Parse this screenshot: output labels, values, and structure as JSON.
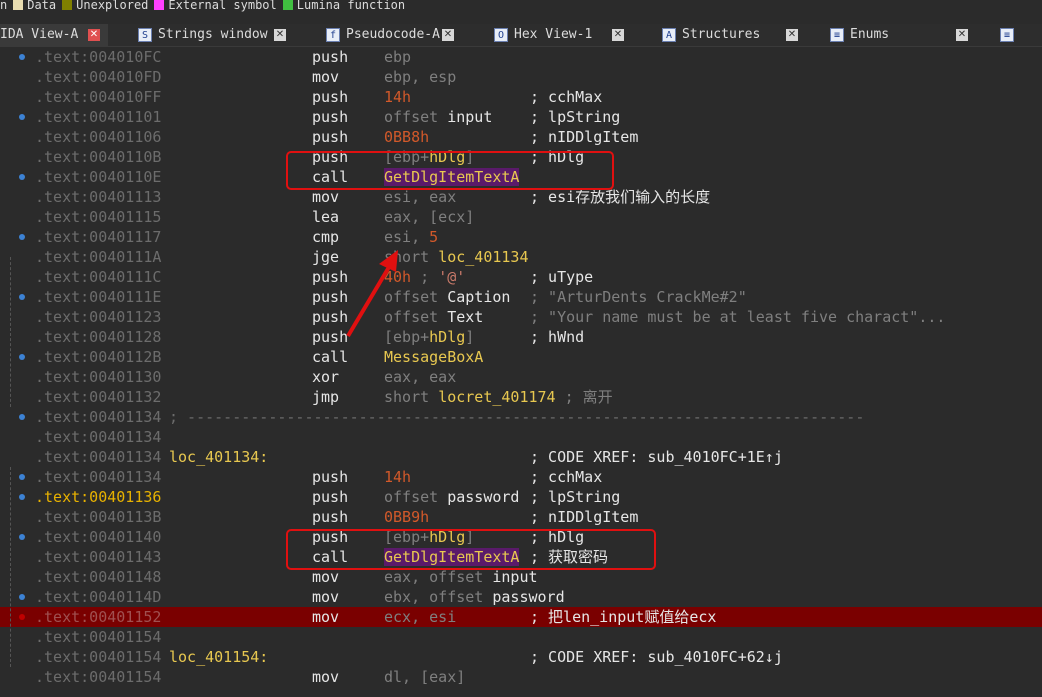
{
  "legend": [
    {
      "label": "n",
      "color": ""
    },
    {
      "label": "Data",
      "color": "#e8dcb0"
    },
    {
      "label": "Unexplored",
      "color": "#808000"
    },
    {
      "label": "External symbol",
      "color": "#ff40ff"
    },
    {
      "label": "Lumina function",
      "color": "#40c040"
    }
  ],
  "tabs": [
    {
      "label": "IDA View-A",
      "icon": "ida-view-icon",
      "glyph": "",
      "active": true
    },
    {
      "label": "Strings window",
      "icon": "strings-icon",
      "glyph": "S",
      "active": false
    },
    {
      "label": "Pseudocode-A",
      "icon": "pseudocode-icon",
      "glyph": "f",
      "active": false
    },
    {
      "label": "Hex View-1",
      "icon": "hex-view-icon",
      "glyph": "O",
      "active": false
    },
    {
      "label": "Structures",
      "icon": "structures-icon",
      "glyph": "A",
      "active": false
    },
    {
      "label": "Enums",
      "icon": "enums-icon",
      "glyph": "≡",
      "active": false
    },
    {
      "label": "",
      "icon": "imports-icon",
      "glyph": "≡",
      "active": false
    }
  ],
  "tab_close_glyph": "✕",
  "listing": [
    {
      "addr": ".text:004010FC",
      "mn": "push",
      "op": [
        [
          "k",
          "ebp"
        ]
      ]
    },
    {
      "addr": ".text:004010FD",
      "mn": "mov",
      "op": [
        [
          "k",
          "ebp, esp"
        ]
      ]
    },
    {
      "addr": ".text:004010FF",
      "mn": "push",
      "op": [
        [
          "n",
          "14h"
        ]
      ],
      "cm": "; cchMax"
    },
    {
      "addr": ".text:00401101",
      "mn": "push",
      "op": [
        [
          "k",
          "offset "
        ],
        [
          "nw",
          "input"
        ]
      ],
      "cm": "; lpString"
    },
    {
      "addr": ".text:00401106",
      "mn": "push",
      "op": [
        [
          "n",
          "0BB8h"
        ]
      ],
      "cm": "; nIDDlgItem"
    },
    {
      "addr": ".text:0040110B",
      "mn": "push",
      "op": [
        [
          "k",
          "[ebp+"
        ],
        [
          "fn",
          "hDlg"
        ],
        [
          "k",
          "]"
        ]
      ],
      "cm": "; hDlg"
    },
    {
      "addr": ".text:0040110E",
      "mn": "call",
      "op": [
        [
          "fnp",
          "GetDlgItemTextA"
        ]
      ]
    },
    {
      "addr": ".text:00401113",
      "mn": "mov",
      "op": [
        [
          "k",
          "esi, eax"
        ]
      ],
      "cm": "; esi存放我们输入的长度"
    },
    {
      "addr": ".text:00401115",
      "mn": "lea",
      "op": [
        [
          "k",
          "eax, [ecx]"
        ]
      ]
    },
    {
      "addr": ".text:00401117",
      "mn": "cmp",
      "op": [
        [
          "k",
          "esi, "
        ],
        [
          "n",
          "5"
        ]
      ]
    },
    {
      "addr": ".text:0040111A",
      "mn": "jge",
      "op": [
        [
          "k",
          "short "
        ],
        [
          "nm",
          "loc_401134"
        ]
      ]
    },
    {
      "addr": ".text:0040111C",
      "mn": "push",
      "op": [
        [
          "n",
          "40h"
        ],
        [
          "k",
          " ; "
        ],
        [
          "ch",
          "'@'"
        ]
      ],
      "cm": "; uType"
    },
    {
      "addr": ".text:0040111E",
      "mn": "push",
      "op": [
        [
          "k",
          "offset "
        ],
        [
          "nw",
          "Caption"
        ]
      ],
      "cm": "; \"ArturDents CrackMe#2\"",
      "cmGray": true
    },
    {
      "addr": ".text:00401123",
      "mn": "push",
      "op": [
        [
          "k",
          "offset "
        ],
        [
          "nw",
          "Text"
        ]
      ],
      "cm": "; \"Your name must be at least five charact\"...",
      "cmGray": true
    },
    {
      "addr": ".text:00401128",
      "mn": "push",
      "op": [
        [
          "k",
          "[ebp+"
        ],
        [
          "fn",
          "hDlg"
        ],
        [
          "k",
          "]"
        ]
      ],
      "cm": "; hWnd"
    },
    {
      "addr": ".text:0040112B",
      "mn": "call",
      "op": [
        [
          "fn",
          "MessageBoxA"
        ]
      ]
    },
    {
      "addr": ".text:00401130",
      "mn": "xor",
      "op": [
        [
          "k",
          "eax, eax"
        ]
      ]
    },
    {
      "addr": ".text:00401132",
      "mn": "jmp",
      "op": [
        [
          "k",
          "short "
        ],
        [
          "nm",
          "locret_401174"
        ],
        [
          "k",
          " ; 离开"
        ]
      ]
    },
    {
      "addr": ".text:00401134",
      "sep": "; ---------------------------------------------------------------------------"
    },
    {
      "addr": ".text:00401134"
    },
    {
      "addr": ".text:00401134",
      "label": "loc_401134:",
      "cm": "; CODE XREF: sub_4010FC+1E↑j"
    },
    {
      "addr": ".text:00401134",
      "mn": "push",
      "op": [
        [
          "n",
          "14h"
        ]
      ],
      "cm": "; cchMax"
    },
    {
      "addr": ".text:00401136",
      "mn": "push",
      "op": [
        [
          "k",
          "offset "
        ],
        [
          "nw",
          "password"
        ]
      ],
      "cm": "; lpString",
      "cur": true
    },
    {
      "addr": ".text:0040113B",
      "mn": "push",
      "op": [
        [
          "n",
          "0BB9h"
        ]
      ],
      "cm": "; nIDDlgItem"
    },
    {
      "addr": ".text:00401140",
      "mn": "push",
      "op": [
        [
          "k",
          "[ebp+"
        ],
        [
          "fn",
          "hDlg"
        ],
        [
          "k",
          "]"
        ]
      ],
      "cm": "; hDlg"
    },
    {
      "addr": ".text:00401143",
      "mn": "call",
      "op": [
        [
          "fnp",
          "GetDlgItemTextA"
        ]
      ],
      "cm": "; 获取密码"
    },
    {
      "addr": ".text:00401148",
      "mn": "mov",
      "op": [
        [
          "k",
          "eax, offset "
        ],
        [
          "nw",
          "input"
        ]
      ]
    },
    {
      "addr": ".text:0040114D",
      "mn": "mov",
      "op": [
        [
          "k",
          "ebx, offset "
        ],
        [
          "nw",
          "password"
        ]
      ]
    },
    {
      "addr": ".text:00401152",
      "mn": "mov",
      "op": [
        [
          "k",
          "ecx, esi"
        ]
      ],
      "cm": "; 把len_input赋值给ecx",
      "hl": true
    },
    {
      "addr": ".text:00401154"
    },
    {
      "addr": ".text:00401154",
      "label": "loc_401154:",
      "cm": "; CODE XREF: sub_4010FC+62↓j"
    },
    {
      "addr": ".text:00401154",
      "mn": "mov",
      "op": [
        [
          "k",
          "dl, [eax]"
        ]
      ]
    }
  ],
  "annotation_colors": {
    "box": "#e01010",
    "arrow": "#e01010"
  }
}
